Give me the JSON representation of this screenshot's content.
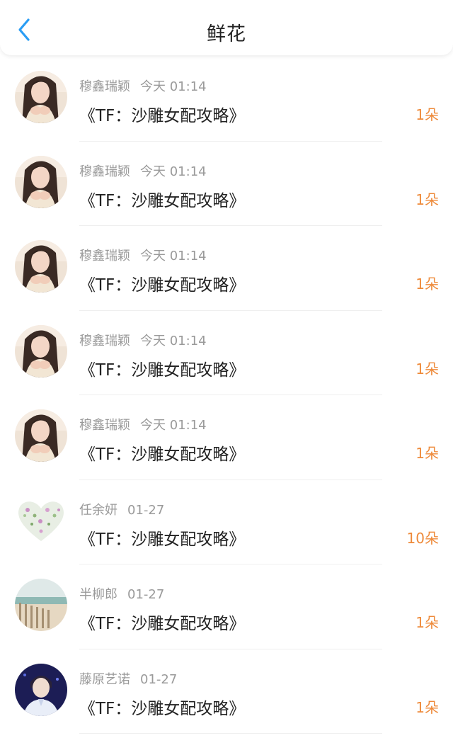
{
  "header": {
    "title": "鲜花",
    "back_icon": "chevron-left-icon",
    "accent_color": "#2a9df4"
  },
  "count_color": "#ee8a3a",
  "rows": [
    {
      "name": "穆鑫瑞颖",
      "time": "今天 01:14",
      "book": "《TF：沙雕女配攻略》",
      "count": "1朵",
      "avatar": "girl"
    },
    {
      "name": "穆鑫瑞颖",
      "time": "今天 01:14",
      "book": "《TF：沙雕女配攻略》",
      "count": "1朵",
      "avatar": "girl"
    },
    {
      "name": "穆鑫瑞颖",
      "time": "今天 01:14",
      "book": "《TF：沙雕女配攻略》",
      "count": "1朵",
      "avatar": "girl"
    },
    {
      "name": "穆鑫瑞颖",
      "time": "今天 01:14",
      "book": "《TF：沙雕女配攻略》",
      "count": "1朵",
      "avatar": "girl"
    },
    {
      "name": "穆鑫瑞颖",
      "time": "今天 01:14",
      "book": "《TF：沙雕女配攻略》",
      "count": "1朵",
      "avatar": "girl"
    },
    {
      "name": "任余妍",
      "time": "01-27",
      "book": "《TF：沙雕女配攻略》",
      "count": "10朵",
      "avatar": "heart"
    },
    {
      "name": "半柳郎",
      "time": "01-27",
      "book": "《TF：沙雕女配攻略》",
      "count": "1朵",
      "avatar": "beach"
    },
    {
      "name": "藤原艺诺",
      "time": "01-27",
      "book": "《TF：沙雕女配攻略》",
      "count": "1朵",
      "avatar": "boy"
    }
  ]
}
